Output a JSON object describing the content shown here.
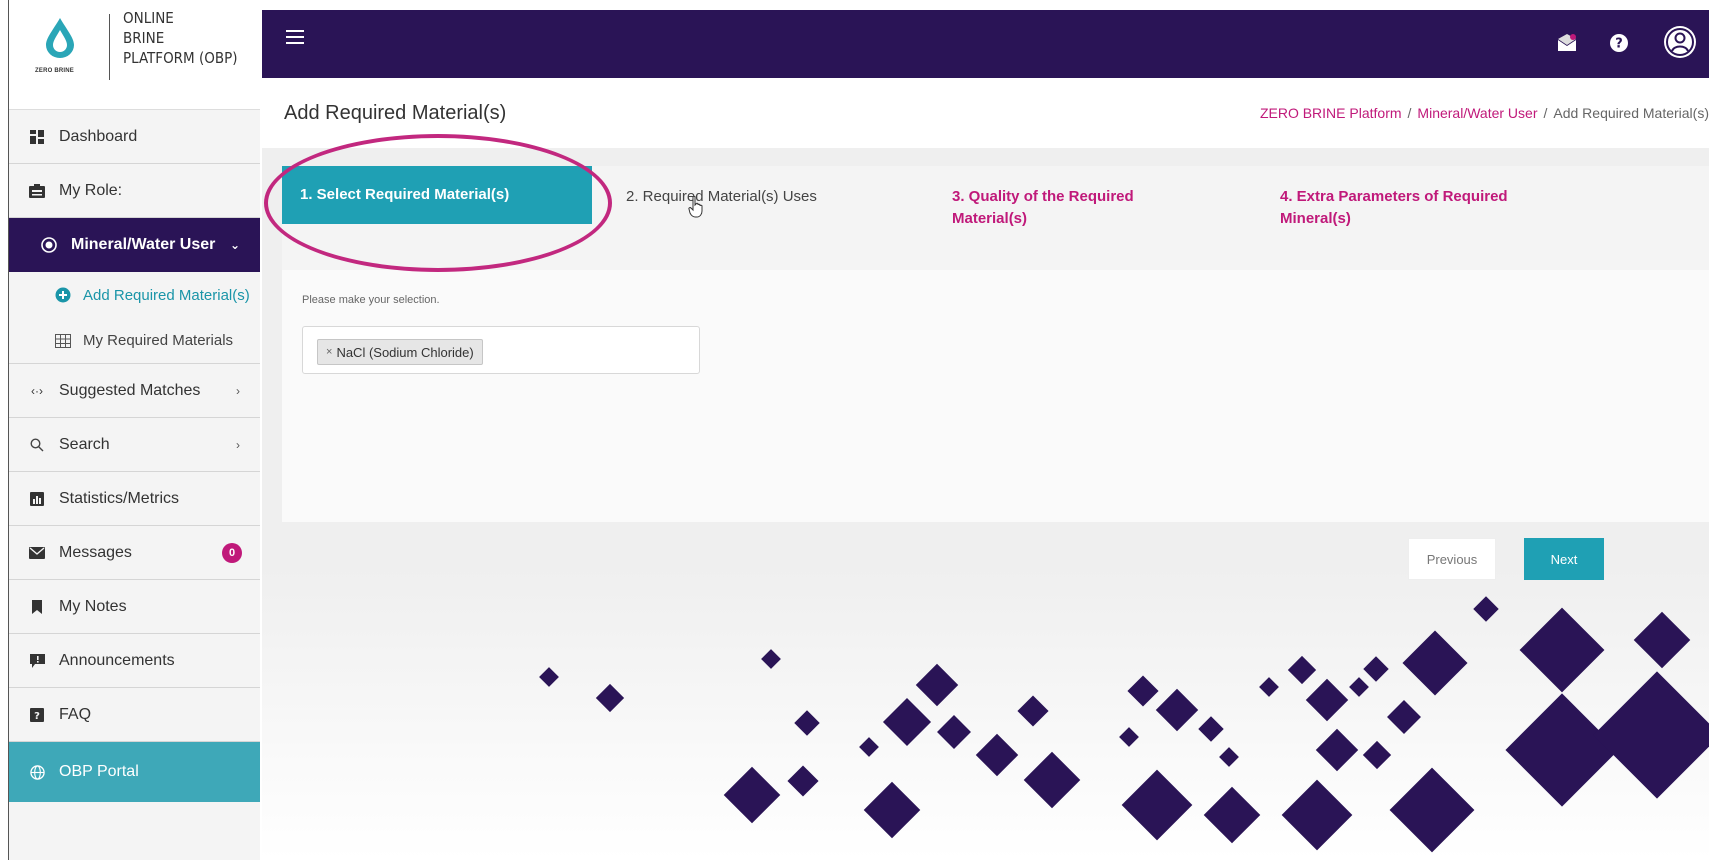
{
  "logo": {
    "small_text": "ZERO BRINE",
    "line1": "ONLINE",
    "line2": "BRINE",
    "line3": "PLATFORM (OBP)",
    "drop_color": "#2aa6b7"
  },
  "sidebar": {
    "dashboard": "Dashboard",
    "my_role": "My Role:",
    "role": "Mineral/Water User",
    "sub_items": [
      {
        "label": "Add Required Material(s)"
      },
      {
        "label": "My Required Materials"
      }
    ],
    "suggested": "Suggested Matches",
    "search": "Search",
    "statistics": "Statistics/Metrics",
    "messages": "Messages",
    "messages_count": "0",
    "notes": "My Notes",
    "announcements": "Announcements",
    "faq": "FAQ",
    "portal": "OBP Portal"
  },
  "header": {
    "title": "Add Required Material(s)",
    "breadcrumb": [
      "ZERO BRINE Platform",
      "Mineral/Water User",
      "Add Required Material(s)"
    ]
  },
  "wizard": {
    "steps": [
      "1. Select Required Material(s)",
      "2. Required Material(s) Uses",
      "3. Quality of the Required Material(s)",
      "4. Extra Parameters of Required Mineral(s)"
    ],
    "help": "Please make your selection.",
    "selected_tag": "NaCl (Sodium Chloride)",
    "tag_remove": "×",
    "previous": "Previous",
    "next": "Next"
  },
  "colors": {
    "primary_dark": "#2a1456",
    "accent_teal": "#1fa0b4",
    "accent_magenta": "#c0197a",
    "annotation": "#c2287f"
  }
}
